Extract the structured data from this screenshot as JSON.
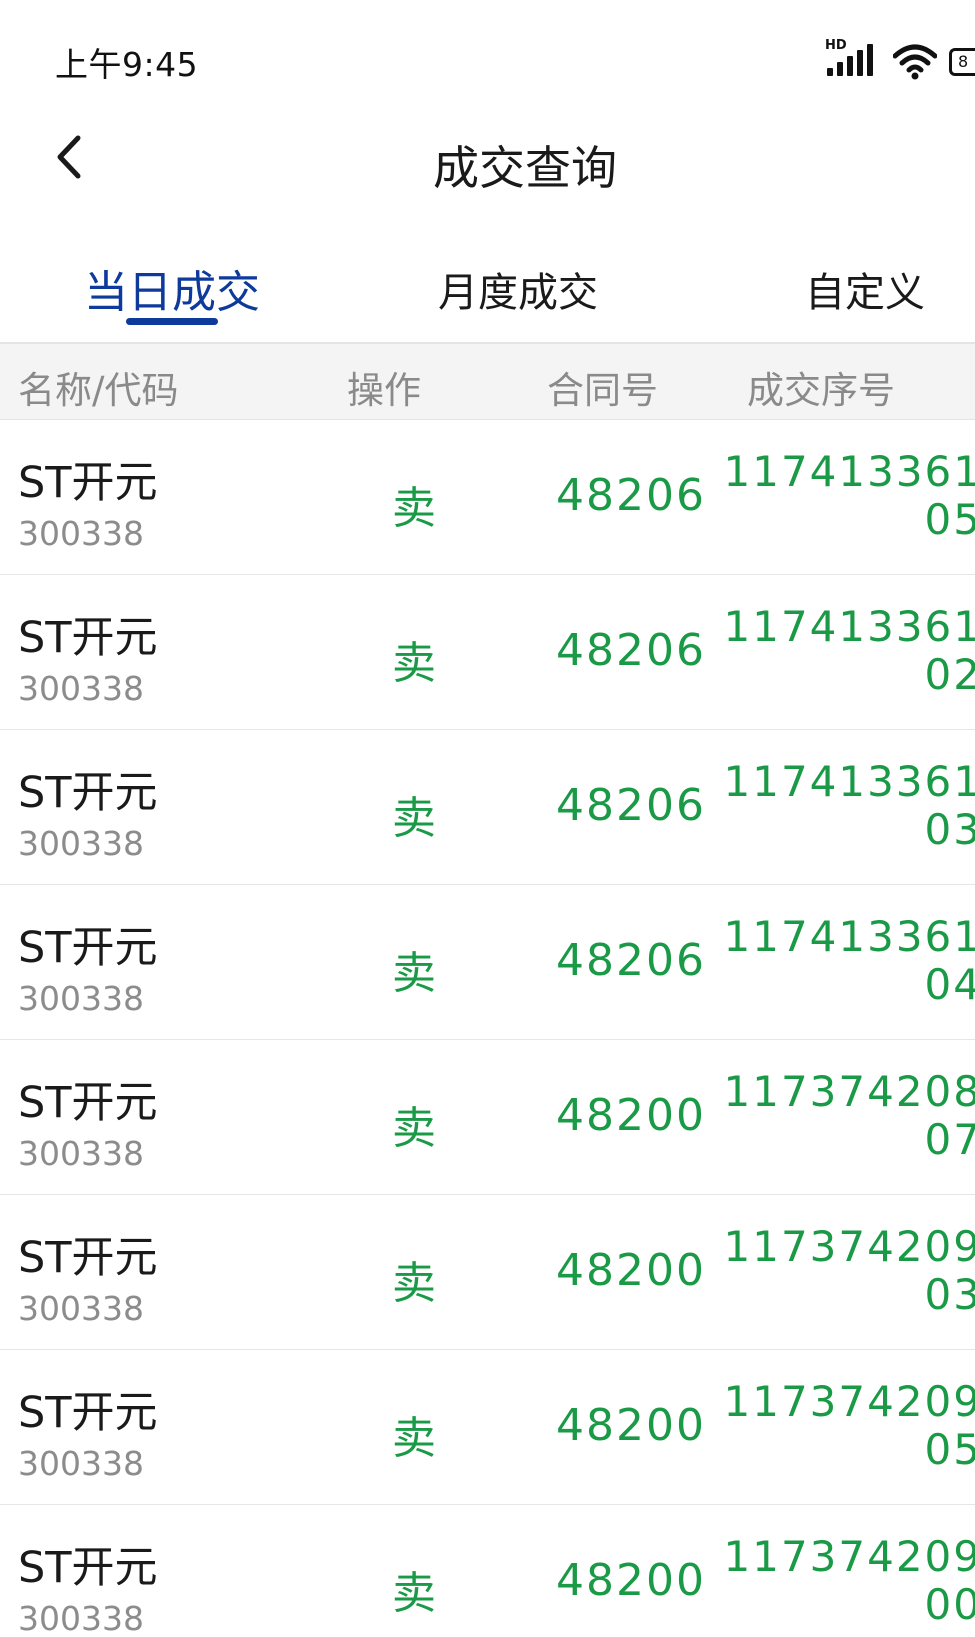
{
  "status_bar": {
    "time": "上午9:45",
    "network_label": "HD",
    "battery_label": "8"
  },
  "header": {
    "title": "成交查询"
  },
  "tabs": [
    {
      "label": "当日成交",
      "active": true
    },
    {
      "label": "月度成交",
      "active": false
    },
    {
      "label": "自定义",
      "active": false
    }
  ],
  "table": {
    "columns": [
      "名称/代码",
      "操作",
      "合同号",
      "成交序号"
    ],
    "rows": [
      {
        "name": "ST开元",
        "code": "300338",
        "op": "卖",
        "contract": "48206",
        "seq": "117413361 05"
      },
      {
        "name": "ST开元",
        "code": "300338",
        "op": "卖",
        "contract": "48206",
        "seq": "117413361 02"
      },
      {
        "name": "ST开元",
        "code": "300338",
        "op": "卖",
        "contract": "48206",
        "seq": "117413361 03"
      },
      {
        "name": "ST开元",
        "code": "300338",
        "op": "卖",
        "contract": "48206",
        "seq": "117413361 04"
      },
      {
        "name": "ST开元",
        "code": "300338",
        "op": "卖",
        "contract": "48200",
        "seq": "117374208 07"
      },
      {
        "name": "ST开元",
        "code": "300338",
        "op": "卖",
        "contract": "48200",
        "seq": "117374209 03"
      },
      {
        "name": "ST开元",
        "code": "300338",
        "op": "卖",
        "contract": "48200",
        "seq": "117374209 05"
      },
      {
        "name": "ST开元",
        "code": "300338",
        "op": "卖",
        "contract": "48200",
        "seq": "117374209 00"
      }
    ]
  },
  "colors": {
    "accent": "#0d3a9b",
    "sell": "#1a9a46"
  }
}
